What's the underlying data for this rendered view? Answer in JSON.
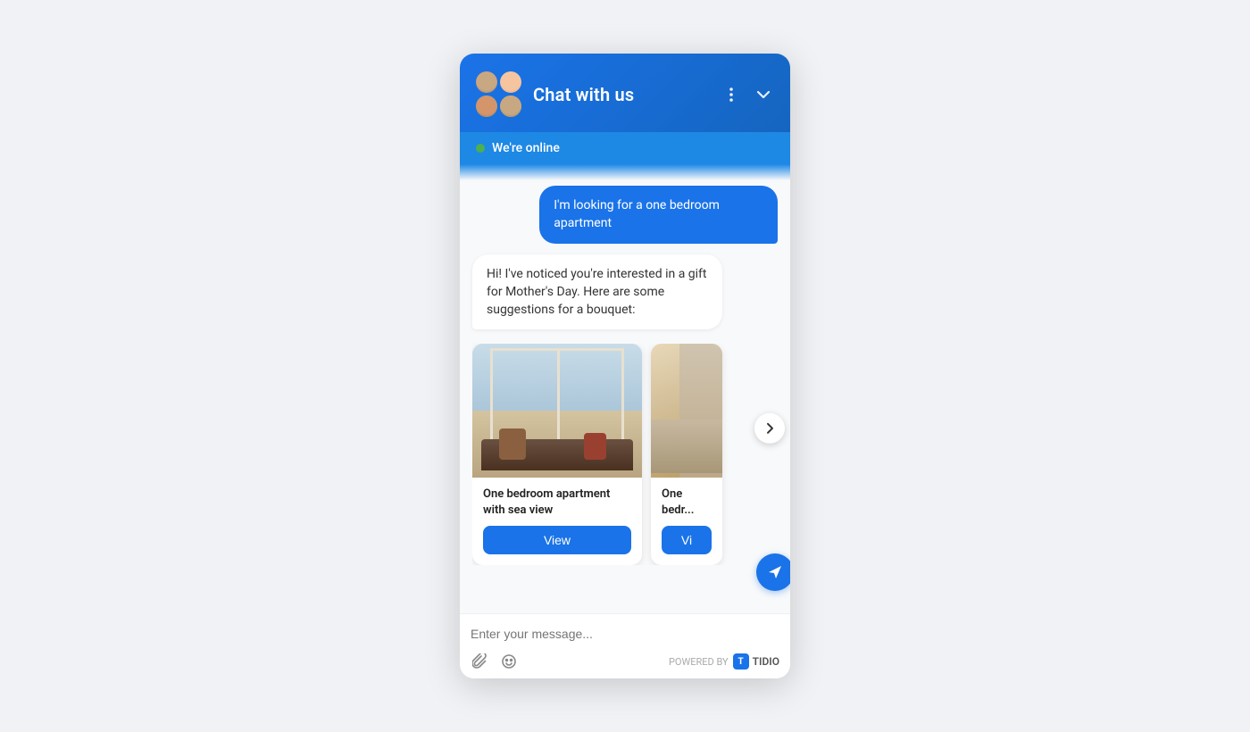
{
  "header": {
    "title": "Chat with us",
    "more_icon": "⋮",
    "collapse_icon": "▾",
    "avatars": [
      {
        "id": 1,
        "label": "agent-1"
      },
      {
        "id": 2,
        "label": "agent-2"
      },
      {
        "id": 3,
        "label": "agent-3"
      },
      {
        "id": 4,
        "label": "agent-4"
      }
    ]
  },
  "status_bar": {
    "online_text": "We're online",
    "indicator_color": "#4caf50"
  },
  "messages": [
    {
      "id": 1,
      "type": "user",
      "text": "I'm looking for a one bedroom apartment"
    },
    {
      "id": 2,
      "type": "bot",
      "text": "Hi! I've noticed you're interested in a gift for Mother's Day. Here are some suggestions for a bouquet:"
    }
  ],
  "products": [
    {
      "id": 1,
      "title": "One bedroom apartment with sea view",
      "button_label": "View"
    },
    {
      "id": 2,
      "title": "One bedroom apartment",
      "button_label": "Vi"
    }
  ],
  "input": {
    "placeholder": "Enter your message...",
    "powered_by_text": "POWERED BY",
    "brand_name": "TIDIO",
    "attach_icon_label": "attach-icon",
    "emoji_icon_label": "emoji-icon",
    "send_icon_label": "send-icon"
  },
  "colors": {
    "primary": "#1a73e8",
    "header_gradient_start": "#1a73e8",
    "header_gradient_end": "#1565c0",
    "online_bar": "#1e88e5",
    "online_dot": "#4caf50",
    "user_bubble": "#1a73e8",
    "bot_bubble": "#ffffff",
    "background": "#f8f9fa",
    "send_button": "#1a73e8"
  }
}
